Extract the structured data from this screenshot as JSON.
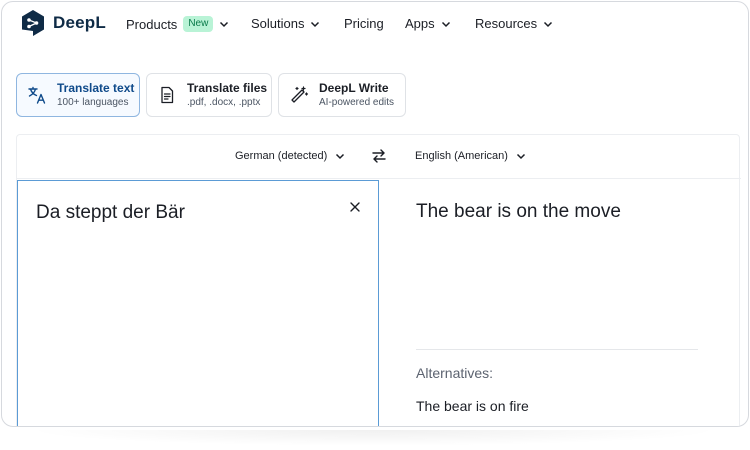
{
  "brand": {
    "name": "DeepL",
    "color": "#0f2b46"
  },
  "nav": {
    "items": [
      {
        "label": "Products",
        "badge": "New"
      },
      {
        "label": "Solutions"
      },
      {
        "label": "Pricing"
      },
      {
        "label": "Apps"
      },
      {
        "label": "Resources"
      }
    ]
  },
  "modes": [
    {
      "title": "Translate text",
      "subtitle": "100+ languages",
      "icon": "translate-icon",
      "active": true
    },
    {
      "title": "Translate files",
      "subtitle": ".pdf, .docx, .pptx",
      "icon": "document-icon",
      "active": false
    },
    {
      "title": "DeepL Write",
      "subtitle": "AI-powered edits",
      "icon": "magic-wand-icon",
      "active": false
    }
  ],
  "translator": {
    "source_language": "German (detected)",
    "target_language": "English (American)",
    "source_text": "Da steppt der Bär",
    "target_text": "The bear is on the move",
    "alternatives_label": "Alternatives:",
    "alternatives": [
      "The bear is on fire"
    ]
  },
  "colors": {
    "accent_border": "#5b9bd5",
    "active_mode_text": "#0f4a8a",
    "badge_bg": "#b9f3d6",
    "badge_text": "#0a7a4a"
  }
}
